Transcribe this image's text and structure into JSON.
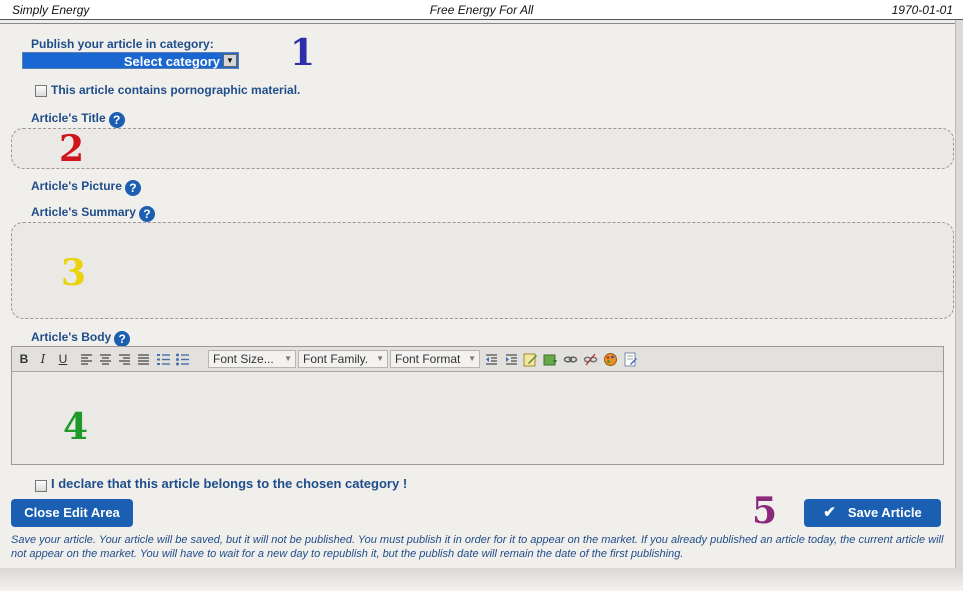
{
  "header": {
    "site_name": "Simply Energy",
    "slogan": "Free Energy For All",
    "date": "1970-01-01"
  },
  "category": {
    "label": "Publish your article in category:",
    "selected": "Select category"
  },
  "adult_checkbox": {
    "label": "This article contains pornographic material.",
    "checked": false
  },
  "fields": {
    "title_label": "Article's Title",
    "picture_label": "Article's Picture",
    "summary_label": "Article's Summary",
    "body_label": "Article's Body"
  },
  "help_glyph": "?",
  "toolbar": {
    "bold": "B",
    "italic": "I",
    "underline": "U",
    "font_size": "Font Size...",
    "font_family": "Font Family.",
    "font_format": "Font Format"
  },
  "annotations": {
    "n1": "1",
    "n2": "2",
    "n3": "3",
    "n4": "4",
    "n5": "5",
    "colors": {
      "n1": "#2b2fa8",
      "n2": "#d0141c",
      "n3": "#e8d30c",
      "n4": "#1f9a2a",
      "n5": "#8b2a7a"
    }
  },
  "declare_checkbox": {
    "label": "I declare that this article belongs to the chosen category !",
    "checked": false
  },
  "buttons": {
    "close": "Close Edit Area",
    "save": "Save Article",
    "save_icon": "✔"
  },
  "note": "Save your article. Your article will be saved, but it will not be published. You must publish it in order for it to appear on the market. If you already published an article today, the current article will not appear on the market. You will have to wait for a new day to republish it, but the publish date will remain the date of the first publishing.",
  "colors": {
    "accent": "#1b5fb3",
    "label": "#1f4d8a",
    "background": "#f1efec"
  }
}
